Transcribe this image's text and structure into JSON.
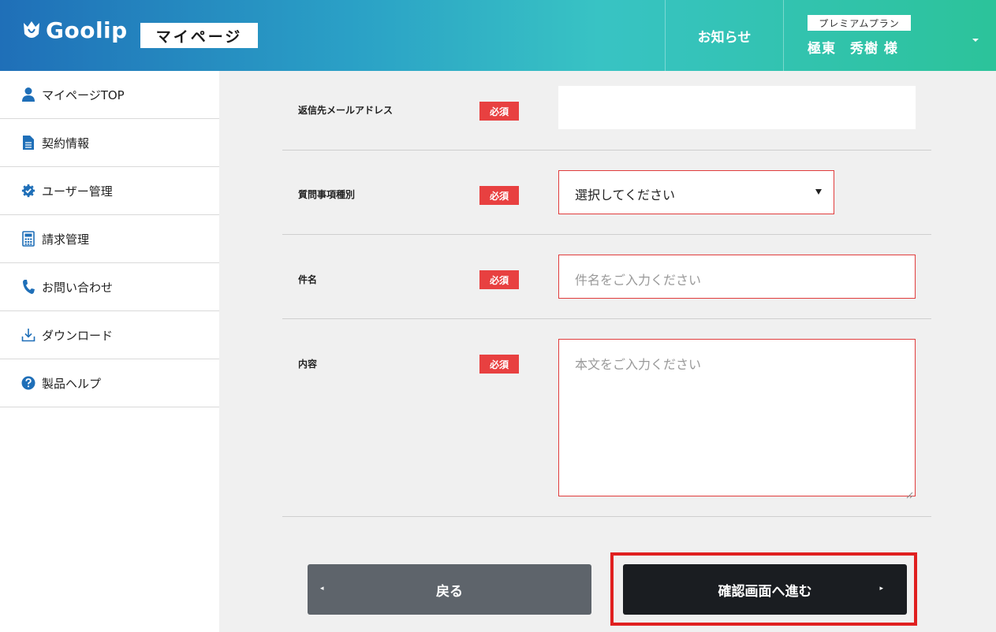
{
  "header": {
    "logo_text": "Goolip",
    "mypage_label": "マイページ",
    "notice_label": "お知らせ",
    "plan_label": "プレミアムプラン",
    "user_name": "極東　秀樹 様"
  },
  "sidebar": {
    "items": [
      {
        "label": "マイページTOP",
        "icon": "user-icon"
      },
      {
        "label": "契約情報",
        "icon": "document-icon"
      },
      {
        "label": "ユーザー管理",
        "icon": "gear-check-icon"
      },
      {
        "label": "請求管理",
        "icon": "calculator-icon"
      },
      {
        "label": "お問い合わせ",
        "icon": "phone-icon"
      },
      {
        "label": "ダウンロード",
        "icon": "download-icon"
      },
      {
        "label": "製品ヘルプ",
        "icon": "help-icon"
      }
    ]
  },
  "form": {
    "required_label": "必須",
    "reply_email": {
      "label": "返信先メールアドレス",
      "value": ""
    },
    "question_type": {
      "label": "質問事項種別",
      "selected": "選択してください"
    },
    "subject": {
      "label": "件名",
      "placeholder": "件名をご入力ください",
      "value": ""
    },
    "content": {
      "label": "内容",
      "placeholder": "本文をご入力ください",
      "value": ""
    }
  },
  "buttons": {
    "back_label": "戻る",
    "next_label": "確認画面へ進む"
  },
  "colors": {
    "required_bg": "#e84040",
    "error_border": "#e03c3c",
    "highlight": "#e02020",
    "back_button": "#5e646b",
    "next_button": "#1a1d21"
  }
}
